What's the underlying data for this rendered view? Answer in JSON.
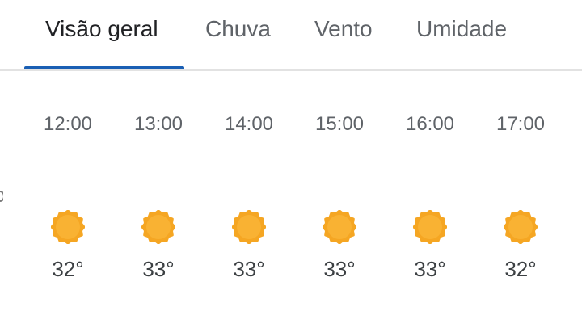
{
  "tabs": [
    {
      "label": "Visão geral",
      "active": true
    },
    {
      "label": "Chuva",
      "active": false
    },
    {
      "label": "Vento",
      "active": false
    },
    {
      "label": "Umidade",
      "active": false
    }
  ],
  "hourly": [
    {
      "time": "12:00",
      "icon": "sun-icon",
      "temp": "32°"
    },
    {
      "time": "13:00",
      "icon": "sun-icon",
      "temp": "33°"
    },
    {
      "time": "14:00",
      "icon": "sun-icon",
      "temp": "33°"
    },
    {
      "time": "15:00",
      "icon": "sun-icon",
      "temp": "33°"
    },
    {
      "time": "16:00",
      "icon": "sun-icon",
      "temp": "33°"
    },
    {
      "time": "17:00",
      "icon": "sun-icon",
      "temp": "32°"
    }
  ],
  "colors": {
    "accent": "#1a5fb4",
    "sun_outer": "#f5a623",
    "sun_inner": "#f9b233"
  }
}
